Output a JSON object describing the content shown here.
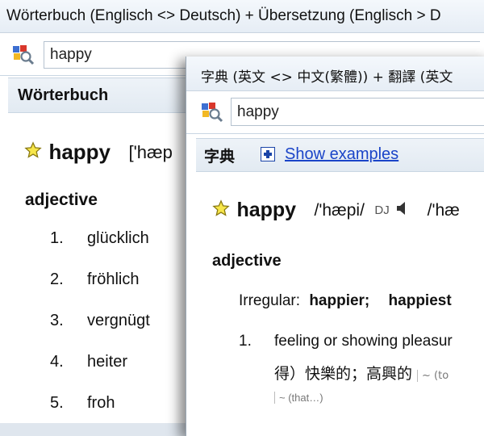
{
  "back_window": {
    "title": "Wörterbuch (Englisch <> Deutsch) + Übersetzung (Englisch > D",
    "search_value": "happy",
    "section_header": "Wörterbuch",
    "headword": "happy",
    "pronunciation": "['hæp",
    "part_of_speech": "adjective",
    "senses": [
      {
        "num": "1.",
        "text": "glücklich"
      },
      {
        "num": "2.",
        "text": "fröhlich"
      },
      {
        "num": "3.",
        "text": "vergnügt"
      },
      {
        "num": "4.",
        "text": "heiter"
      },
      {
        "num": "5.",
        "text": "froh"
      }
    ]
  },
  "front_window": {
    "title": "字典 (英文 <> 中文(繁體)) + 翻譯 (英文",
    "search_value": "happy",
    "section_header": "字典",
    "show_examples": "Show examples",
    "headword": "happy",
    "pronunciation": "/'hæpi/",
    "pron_label": "DJ",
    "pronunciation2": "/'hæ",
    "part_of_speech": "adjective",
    "irregular_label": "Irregular:",
    "irregular_forms": [
      "happier;",
      "happiest"
    ],
    "sense_num": "1.",
    "sense_text": "feeling or showing pleasur",
    "sense_chinese": "得）快樂的；高興的",
    "example_1": "~ (to",
    "example_2": "~ (that…)"
  },
  "colors": {
    "link": "#1a44c8",
    "star_fill": "#f7e64a",
    "header_bg": "#e6edf5"
  }
}
